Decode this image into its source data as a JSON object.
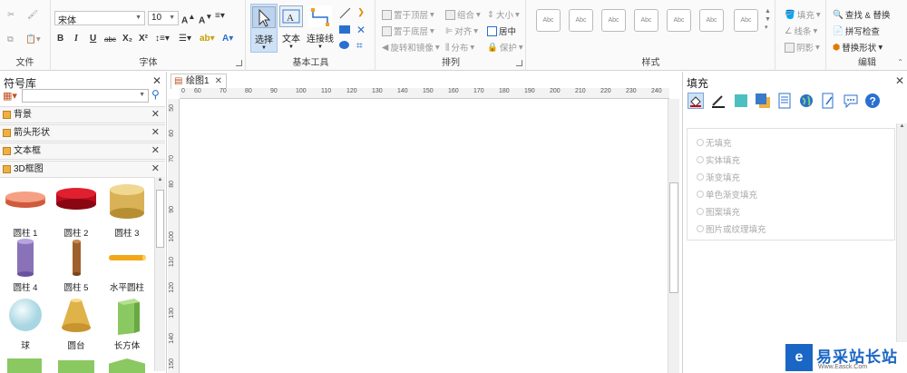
{
  "ribbon": {
    "groups": {
      "file": "文件",
      "font": "字体",
      "basic_tools": "基本工具",
      "arrange": "排列",
      "style": "样式",
      "edit": "编辑"
    },
    "font_name": "宋体",
    "font_size": "10",
    "format_buttons": [
      "B",
      "I",
      "U",
      "abc",
      "X₂",
      "X²"
    ],
    "tools": {
      "select": "选择",
      "text": "文本",
      "connector": "连接线"
    },
    "arrange": {
      "bring_front": "置于顶层",
      "send_back": "置于底层",
      "rotate": "旋转和镜像",
      "group": "组合",
      "align": "对齐",
      "distribute": "分布",
      "size": "大小",
      "center": "居中",
      "protect": "保护"
    },
    "style_box_label": "Abc",
    "style_right": {
      "fill": "填充",
      "line": "线条",
      "shadow": "阴影"
    },
    "edit": {
      "find_replace": "查找 & 替换",
      "spell_check": "拼写检查",
      "replace_shape": "替换形状"
    }
  },
  "library": {
    "title": "符号库",
    "categories": [
      "背景",
      "箭头形状",
      "文本框",
      "3D框图"
    ],
    "shapes": [
      {
        "label": "圆柱 1",
        "icon": "cylinder-flat-salmon"
      },
      {
        "label": "圆柱 2",
        "icon": "cylinder-flat-red"
      },
      {
        "label": "圆柱 3",
        "icon": "cylinder-gold"
      },
      {
        "label": "圆柱 4",
        "icon": "cylinder-tall-purple"
      },
      {
        "label": "圆柱 5",
        "icon": "cylinder-thin-brown"
      },
      {
        "label": "水平圆柱",
        "icon": "cylinder-horizontal-orange"
      },
      {
        "label": "球",
        "icon": "sphere-blue"
      },
      {
        "label": "圆台",
        "icon": "frustum-gold"
      },
      {
        "label": "长方体",
        "icon": "cuboid-green"
      }
    ]
  },
  "canvas": {
    "tab": "绘图1",
    "hruler": [
      "0",
      "60",
      "70",
      "80",
      "90",
      "100",
      "110",
      "120",
      "130",
      "140",
      "150",
      "160",
      "170",
      "180",
      "190",
      "200",
      "210",
      "220",
      "230",
      "240"
    ],
    "vruler": [
      "50",
      "60",
      "70",
      "80",
      "90",
      "100",
      "110",
      "120",
      "130",
      "140",
      "150"
    ]
  },
  "fill_panel": {
    "title": "填充",
    "options": [
      "无填充",
      "实体填充",
      "渐变填充",
      "单色渐变填充",
      "图案填充",
      "图片或纹理填充"
    ],
    "icons": [
      "fill-bucket-icon",
      "line-pen-icon",
      "teal-square-icon",
      "shadow-square-icon",
      "document-icon",
      "globe-icon",
      "page-edit-icon",
      "comment-icon",
      "help-icon"
    ]
  },
  "watermark": {
    "name": "易采站长站",
    "url": "Www.Easck.Com"
  }
}
